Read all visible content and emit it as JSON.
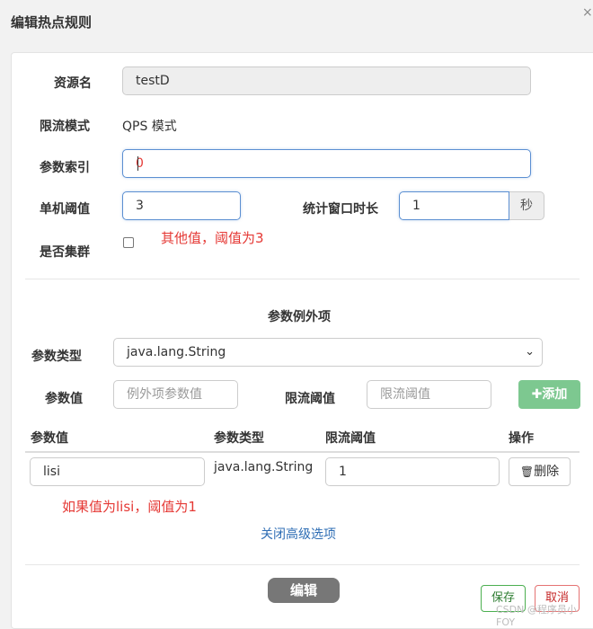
{
  "dialog": {
    "title": "编辑热点规则",
    "close_icon": "×"
  },
  "form": {
    "resource_label": "资源名",
    "resource_value": "testD",
    "mode_label": "限流模式",
    "mode_value": "QPS 模式",
    "param_index_label": "参数索引",
    "param_index_value": "0",
    "threshold_label": "单机阈值",
    "threshold_value": "3",
    "window_label": "统计窗口时长",
    "window_value": "1",
    "window_unit": "秒",
    "cluster_label": "是否集群",
    "cluster_checked": false
  },
  "annotations": {
    "other_values": "其他值，阈值为3",
    "lisi_note": "如果值为lisi，阈值为1"
  },
  "exceptions": {
    "section_title": "参数例外项",
    "type_label": "参数类型",
    "type_selected": "java.lang.String",
    "value_label": "参数值",
    "value_placeholder": "例外项参数值",
    "limit_label": "限流阈值",
    "limit_placeholder": "限流阈值",
    "add_button": "添加",
    "columns": [
      "参数值",
      "参数类型",
      "限流阈值",
      "操作"
    ],
    "rows": [
      {
        "value": "lisi",
        "type": "java.lang.String",
        "limit": "1",
        "action": "删除"
      }
    ],
    "toggle_link": "关闭高级选项"
  },
  "footer": {
    "edit_button": "编辑",
    "save_button": "保存",
    "cancel_button": "取消",
    "watermark": "CSDN @程序员小FOY"
  }
}
